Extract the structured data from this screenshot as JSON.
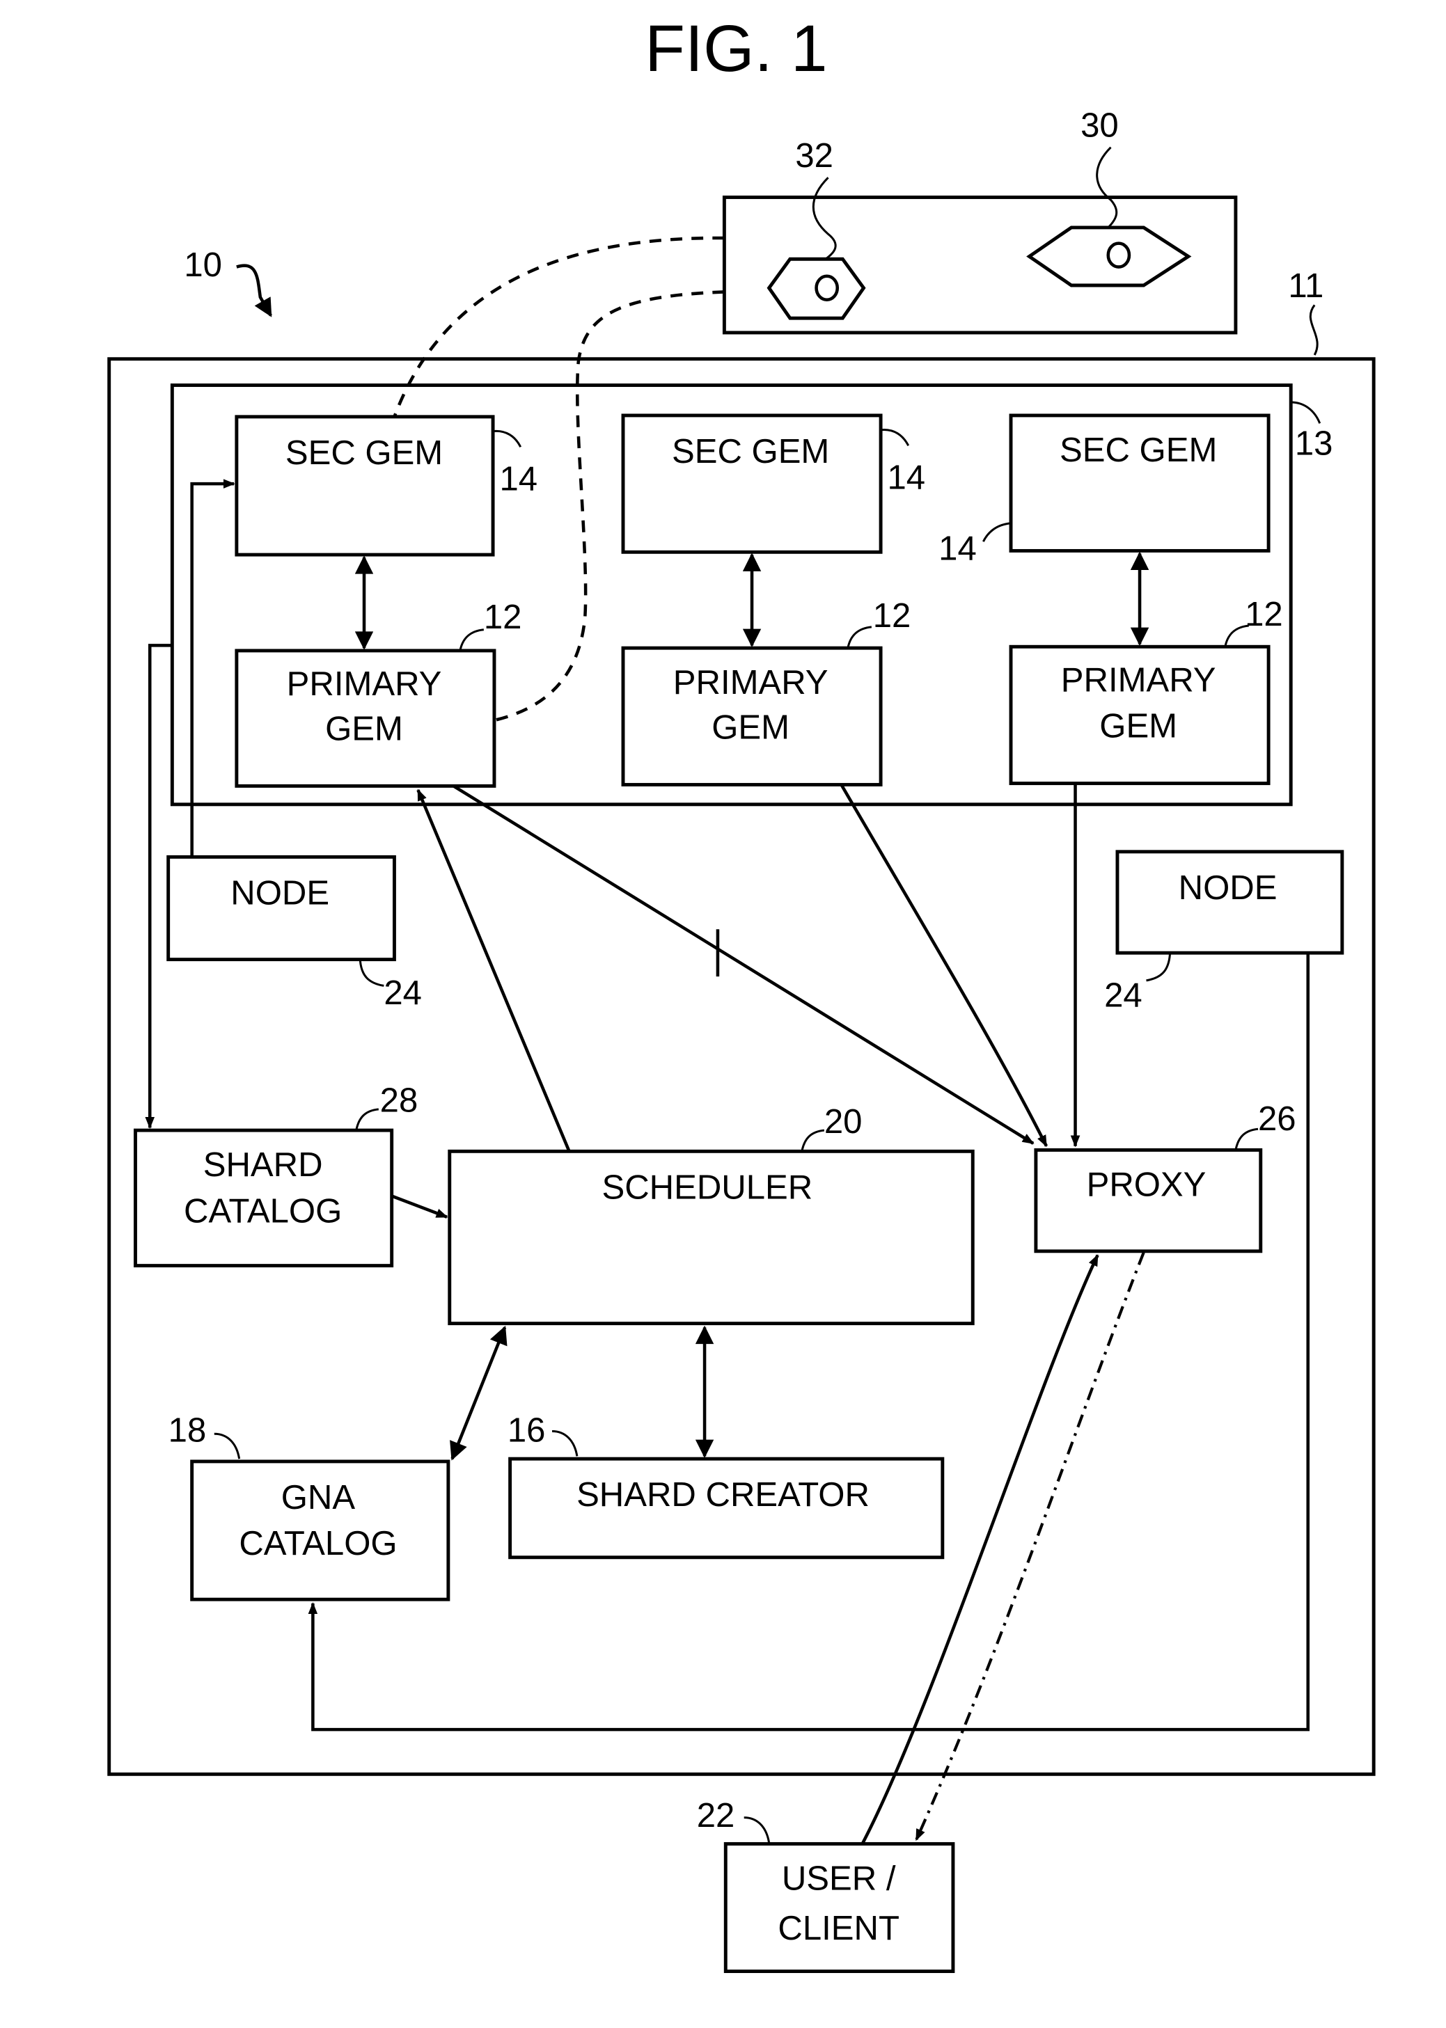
{
  "figure": {
    "title": "FIG. 1",
    "system_ref": "10",
    "outer_ref": "11",
    "cluster_ref": "13"
  },
  "top_panel": {
    "items": [
      {
        "ref": "32",
        "shape": "hexagon-icon"
      },
      {
        "ref": "30",
        "shape": "hexagon-icon"
      }
    ]
  },
  "gems": [
    {
      "sec_label": "SEC GEM",
      "sec_ref": "14",
      "primary_line1": "PRIMARY",
      "primary_line2": "GEM",
      "primary_ref": "12"
    },
    {
      "sec_label": "SEC GEM",
      "sec_ref": "14",
      "primary_line1": "PRIMARY",
      "primary_line2": "GEM",
      "primary_ref": "12"
    },
    {
      "sec_label": "SEC GEM",
      "sec_ref": "14",
      "primary_line1": "PRIMARY",
      "primary_line2": "GEM",
      "primary_ref": "12"
    }
  ],
  "nodes": [
    {
      "label": "NODE",
      "ref": "24"
    },
    {
      "label": "NODE",
      "ref": "24"
    }
  ],
  "shard_catalog": {
    "line1": "SHARD",
    "line2": "CATALOG",
    "ref": "28"
  },
  "scheduler": {
    "label": "SCHEDULER",
    "ref": "20"
  },
  "proxy": {
    "label": "PROXY",
    "ref": "26"
  },
  "gna_catalog": {
    "line1": "GNA",
    "line2": "CATALOG",
    "ref": "18"
  },
  "shard_creator": {
    "label": "SHARD CREATOR",
    "ref": "16"
  },
  "user_client": {
    "line1": "USER /",
    "line2": "CLIENT",
    "ref": "22"
  }
}
